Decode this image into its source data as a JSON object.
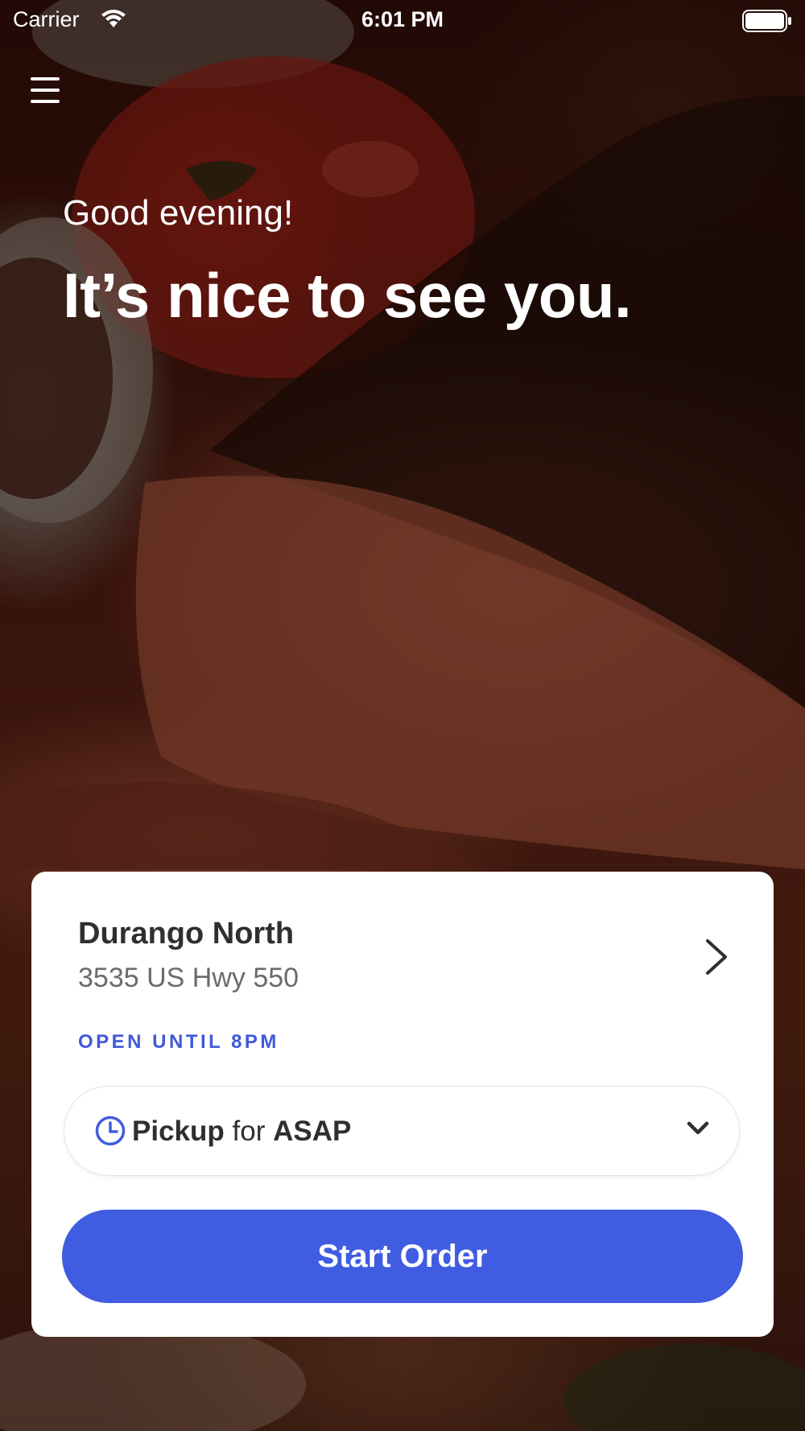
{
  "status_bar": {
    "carrier": "Carrier",
    "time": "6:01 PM"
  },
  "hero": {
    "greeting": "Good evening!",
    "headline": "It’s nice to see you."
  },
  "location": {
    "name": "Durango North",
    "address": "3535 US Hwy 550",
    "hours": "OPEN UNTIL 8PM"
  },
  "order_method": {
    "mode": "Pickup",
    "connector": "for",
    "timing": "ASAP"
  },
  "start_order_label": "Start Order",
  "colors": {
    "accent": "#405ce0",
    "card_background": "#ffffff",
    "text_primary": "#2f2f2f",
    "text_secondary": "#6b6b6b"
  },
  "icons": {
    "menu": "hamburger-menu-icon",
    "location_arrow": "chevron-right-icon",
    "time": "clock-icon",
    "dropdown": "chevron-down-icon"
  }
}
